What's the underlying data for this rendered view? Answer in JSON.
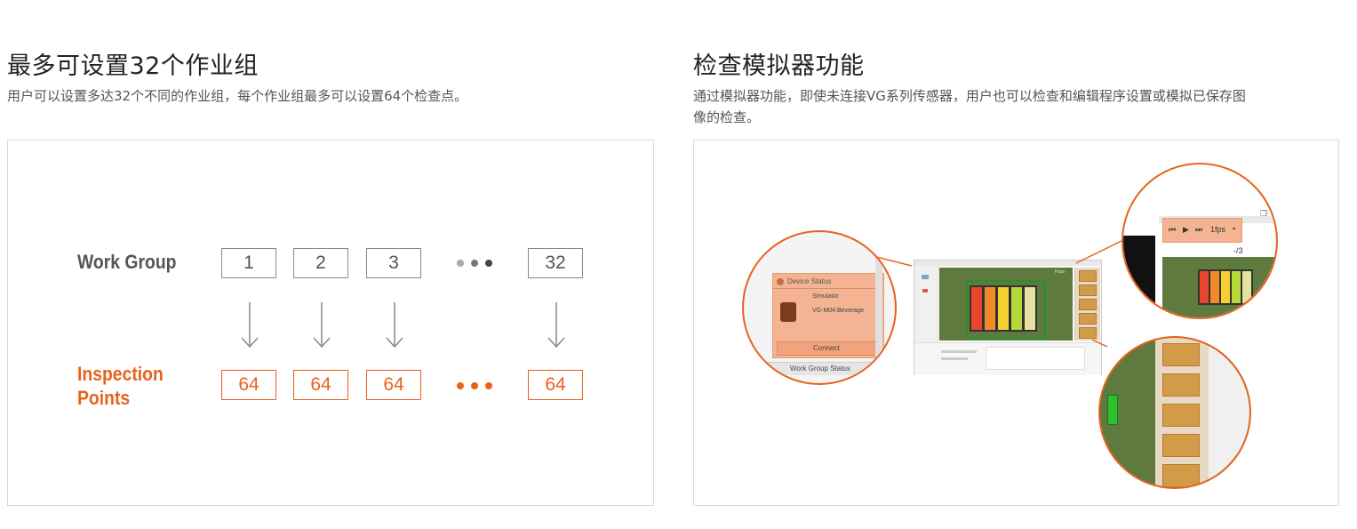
{
  "left": {
    "heading": "最多可设置32个作业组",
    "description": "用户可以设置多达32个不同的作业组，每个作业组最多可以设置64个检查点。",
    "diagram": {
      "work_group_label": "Work Group",
      "inspection_label_line1": "Inspection",
      "inspection_label_line2": "Points",
      "groups": [
        "1",
        "2",
        "3",
        "32"
      ],
      "points": [
        "64",
        "64",
        "64",
        "64"
      ],
      "accent_color": "#e8621d",
      "neutral_color": "#888888"
    }
  },
  "right": {
    "heading": "检查模拟器功能",
    "description_line1": "通过模拟器功能，即使未连接VG系列传感器，用户也可以检查和编辑程序设置或模拟已保存图",
    "description_line2": "像的检查。",
    "screenshot": {
      "device_status": "Device Status",
      "simulator": "Simulator",
      "device_model": "VG-M04:Beverage",
      "connect": "Connect",
      "work_group_status": "Work Group Status",
      "fps": "1fps",
      "counter": "-/3",
      "pass_label": "Pass"
    }
  }
}
